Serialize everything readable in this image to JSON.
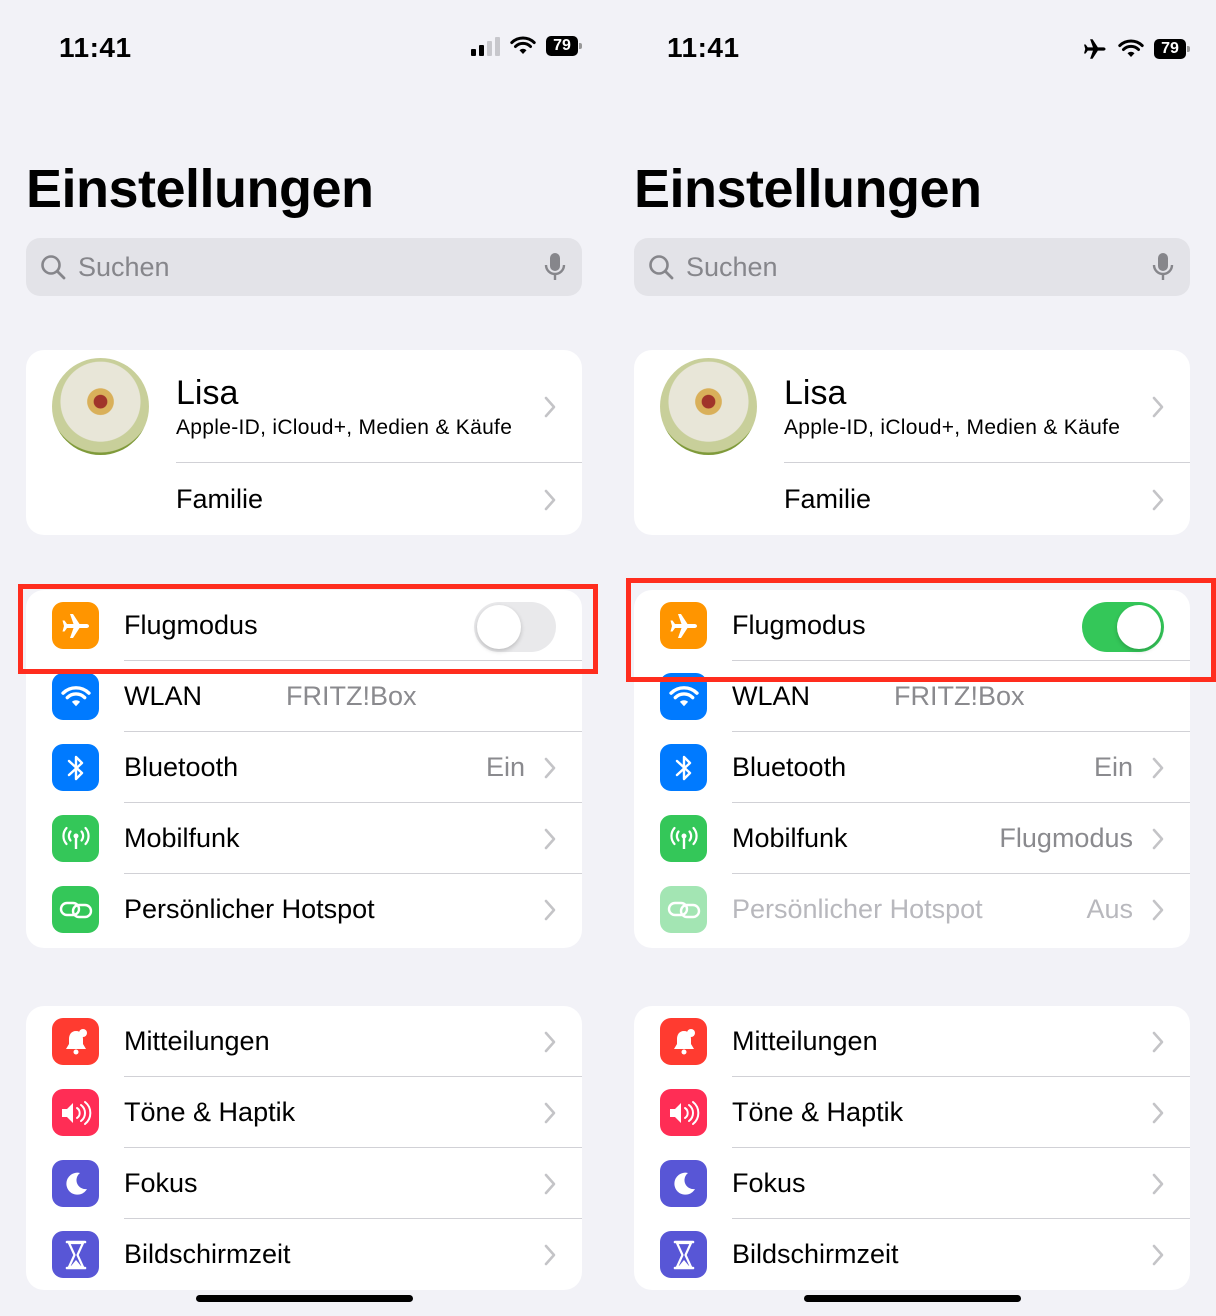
{
  "screens": [
    {
      "status": {
        "time": "11:41",
        "battery": "79",
        "mode": "cellular"
      },
      "title": "Einstellungen",
      "search": {
        "placeholder": "Suchen"
      },
      "profile": {
        "name": "Lisa",
        "subtitle": "Apple-ID, iCloud+, Medien & Käufe",
        "family": "Familie"
      },
      "airplane": {
        "label": "Flugmodus",
        "on": false
      },
      "connectivity": [
        {
          "label": "WLAN",
          "value": "FRITZ!Box"
        },
        {
          "label": "Bluetooth",
          "value": "Ein"
        },
        {
          "label": "Mobilfunk",
          "value": ""
        },
        {
          "label": "Persönlicher Hotspot",
          "value": ""
        }
      ],
      "general": [
        {
          "label": "Mitteilungen"
        },
        {
          "label": "Töne & Haptik"
        },
        {
          "label": "Fokus"
        },
        {
          "label": "Bildschirmzeit"
        }
      ]
    },
    {
      "status": {
        "time": "11:41",
        "battery": "79",
        "mode": "airplane"
      },
      "title": "Einstellungen",
      "search": {
        "placeholder": "Suchen"
      },
      "profile": {
        "name": "Lisa",
        "subtitle": "Apple-ID, iCloud+, Medien & Käufe",
        "family": "Familie"
      },
      "airplane": {
        "label": "Flugmodus",
        "on": true
      },
      "connectivity": [
        {
          "label": "WLAN",
          "value": "FRITZ!Box"
        },
        {
          "label": "Bluetooth",
          "value": "Ein"
        },
        {
          "label": "Mobilfunk",
          "value": "Flugmodus"
        },
        {
          "label": "Persönlicher Hotspot",
          "value": "Aus"
        }
      ],
      "general": [
        {
          "label": "Mitteilungen"
        },
        {
          "label": "Töne & Haptik"
        },
        {
          "label": "Fokus"
        },
        {
          "label": "Bildschirmzeit"
        }
      ]
    }
  ],
  "colors": {
    "airplane": "#ff9500",
    "wlan": "#007aff",
    "bluetooth": "#007aff",
    "mobilfunk": "#34c759",
    "hotspot": "#34c759",
    "mitteilungen": "#ff3b30",
    "toene": "#ff2d55",
    "fokus": "#5856d6",
    "bildschirmzeit": "#5856d6",
    "toggle_on": "#34c759",
    "highlight": "#ff2d1e"
  }
}
